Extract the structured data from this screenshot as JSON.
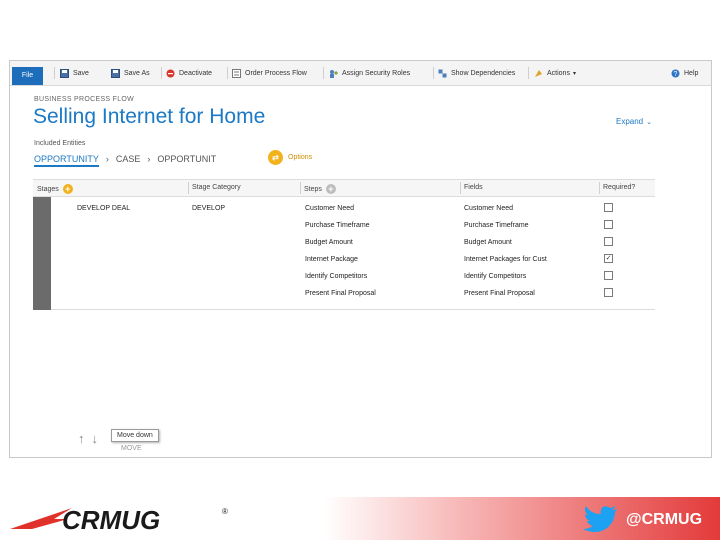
{
  "toolbar": {
    "file": "File",
    "items": [
      "Save",
      "Save As",
      "Deactivate",
      "Order Process Flow",
      "Assign Security Roles",
      "Show Dependencies",
      "Actions",
      "Help"
    ]
  },
  "process": {
    "breadcrumb": "BUSINESS PROCESS FLOW",
    "title": "Selling Internet for Home",
    "expand": "Expand",
    "entities_label": "Included Entities",
    "entities": [
      "OPPORTUNITY",
      "CASE",
      "OPPORTUNIT"
    ],
    "options": "Options"
  },
  "grid": {
    "headers": {
      "stages": "Stages",
      "stage_category": "Stage Category",
      "steps": "Steps",
      "fields": "Fields",
      "required": "Required?"
    },
    "stage": {
      "name": "DEVELOP DEAL",
      "category": "DEVELOP"
    },
    "rows": [
      {
        "step": "Customer Need",
        "field": "Customer Need",
        "required": ""
      },
      {
        "step": "Purchase Timeframe",
        "field": "Purchase Timeframe",
        "required": ""
      },
      {
        "step": "Budget Amount",
        "field": "Budget Amount",
        "required": ""
      },
      {
        "step": "Internet Package",
        "field": "Internet Packages for Cust",
        "required": "✓"
      },
      {
        "step": "Identify Competitors",
        "field": "Identify Competitors",
        "required": ""
      },
      {
        "step": "Present Final Proposal",
        "field": "Present Final Proposal",
        "required": ""
      }
    ]
  },
  "move": {
    "label": "MOVE",
    "tooltip": "Move down"
  },
  "footer": {
    "logo_text": "CRMUG",
    "registered": "®",
    "handle": "@CRMUG"
  },
  "colors": {
    "accent_blue": "#1c79c4",
    "option_orange": "#f2b21c",
    "brand_red": "#e33a3a"
  }
}
